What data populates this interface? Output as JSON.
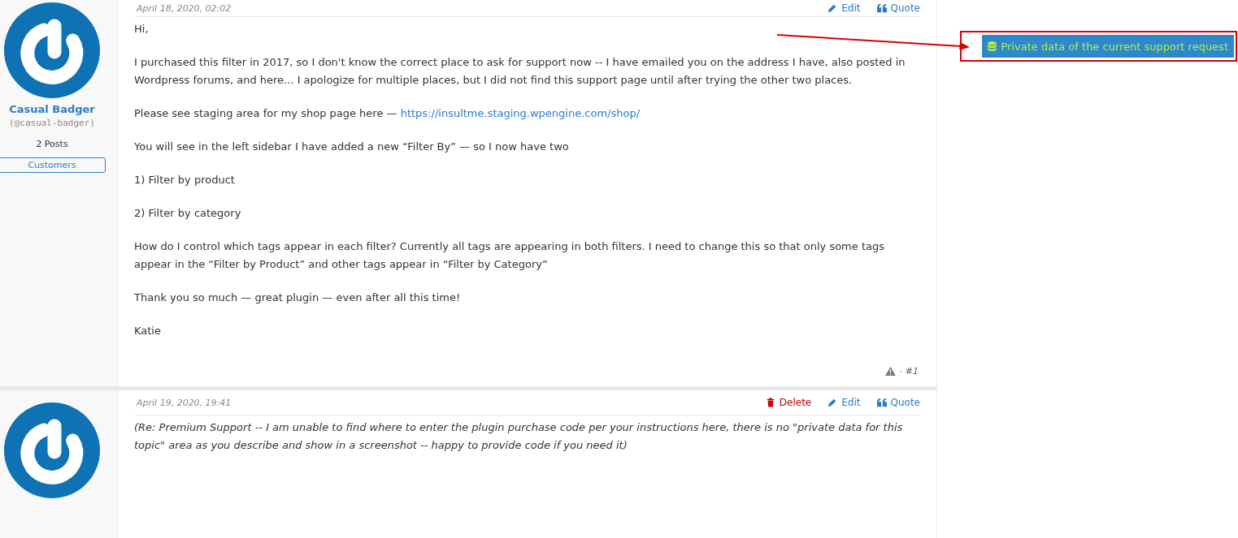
{
  "posts": [
    {
      "date": "April 18, 2020, 02:02",
      "italic": false,
      "author": {
        "name": "Casual Badger",
        "handle": "(@casual-badger)",
        "posts": "2 Posts",
        "role": "Customers"
      },
      "actions": [
        {
          "kind": "edit",
          "label": "Edit"
        },
        {
          "kind": "quote",
          "label": "Quote"
        }
      ],
      "paragraphs": [
        {
          "text": "Hi,"
        },
        {
          "text": "I purchased this filter in 2017, so I don't know the correct place to ask for support now -- I have emailed you on the address I have, also posted in Wordpress forums, and here... I apologize for multiple places, but I did not find this support page until after trying the other two places."
        },
        {
          "text": "Please see staging area for my shop page here — ",
          "link": "https://insultme.staging.wpengine.com/shop/"
        },
        {
          "text": "You will see in the left sidebar I have added a new “Filter By” — so I now have two"
        },
        {
          "text": "1) Filter by product"
        },
        {
          "text": "2) Filter by category"
        },
        {
          "text": "How do I control which tags appear in each filter?  Currently all tags are appearing in both filters.  I need to change this so that only some tags appear in the “Filter by Product” and other tags appear in “Filter by Category”"
        },
        {
          "text": "Thank you so much — great plugin — even after all this time!"
        },
        {
          "text": "Katie"
        }
      ],
      "footer": {
        "separator": "·",
        "ref": "#1"
      }
    },
    {
      "date": "April 19, 2020, 19:41",
      "italic": true,
      "actions": [
        {
          "kind": "delete",
          "label": "Delete"
        },
        {
          "kind": "edit",
          "label": "Edit"
        },
        {
          "kind": "quote",
          "label": "Quote"
        }
      ],
      "paragraphs": [
        {
          "text": "(Re: Premium Support -- I am unable to find where to enter the plugin purchase code per your instructions here, there is no \"private data for this topic\" area as you describe and show in a screenshot -- happy to provide code if you need it)"
        }
      ]
    }
  ],
  "private_data_button": {
    "label": "Private data of the current support request"
  }
}
